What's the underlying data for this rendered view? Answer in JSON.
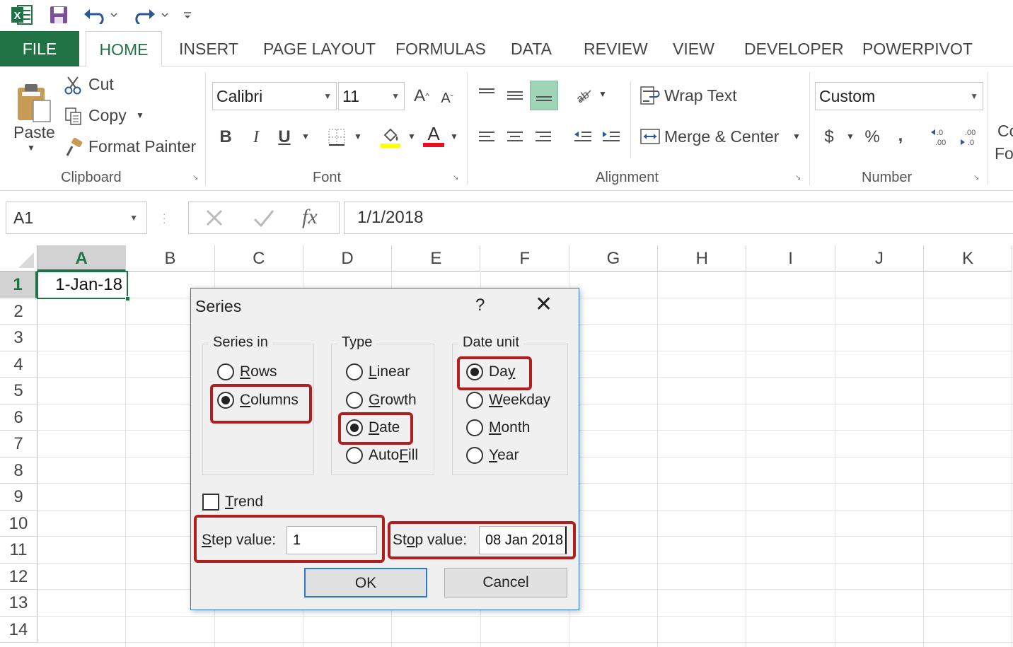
{
  "qat": {
    "icons": [
      "excel-logo-icon",
      "save-icon",
      "undo-icon",
      "redo-icon",
      "customize-qat-icon"
    ]
  },
  "tabs": [
    "FILE",
    "HOME",
    "INSERT",
    "PAGE LAYOUT",
    "FORMULAS",
    "DATA",
    "REVIEW",
    "VIEW",
    "DEVELOPER",
    "POWERPIVOT"
  ],
  "active_tab": "HOME",
  "ribbon": {
    "clipboard": {
      "paste": "Paste",
      "cut": "Cut",
      "copy": "Copy",
      "format_painter": "Format Painter",
      "label": "Clipboard"
    },
    "font": {
      "font_name": "Calibri",
      "font_size": "11",
      "bold": "B",
      "italic": "I",
      "underline": "U",
      "label": "Font"
    },
    "alignment": {
      "wrap_text": "Wrap Text",
      "merge_center": "Merge & Center",
      "label": "Alignment"
    },
    "number": {
      "format": "Custom",
      "currency": "$",
      "percent": "%",
      "comma": ",",
      "label": "Number"
    },
    "overflow_top": "Co",
    "overflow_bottom": "Fo"
  },
  "formula_bar": {
    "name_box": "A1",
    "fx": "fx",
    "value": "1/1/2018"
  },
  "grid": {
    "columns": [
      "A",
      "B",
      "C",
      "D",
      "E",
      "F",
      "G",
      "H",
      "I",
      "J",
      "K"
    ],
    "rows": [
      "1",
      "2",
      "3",
      "4",
      "5",
      "6",
      "7",
      "8",
      "9",
      "10",
      "11",
      "12",
      "13",
      "14"
    ],
    "a1_value": "1-Jan-18"
  },
  "dialog": {
    "title": "Series",
    "help": "?",
    "close": "✕",
    "series_in": {
      "legend": "Series in",
      "options": [
        {
          "label_ul": "R",
          "label_rest": "ows",
          "selected": false
        },
        {
          "label_ul": "C",
          "label_rest": "olumns",
          "selected": true
        }
      ]
    },
    "type": {
      "legend": "Type",
      "options": [
        {
          "label_ul": "L",
          "label_rest": "inear",
          "selected": false
        },
        {
          "label_ul": "G",
          "label_rest": "rowth",
          "selected": false
        },
        {
          "label_ul": "D",
          "label_rest": "ate",
          "selected": true
        },
        {
          "label_pre": "Auto",
          "label_ul": "F",
          "label_rest": "ill",
          "selected": false
        }
      ]
    },
    "date_unit": {
      "legend": "Date unit",
      "options": [
        {
          "label_pre": "Da",
          "label_ul": "y",
          "label_rest": "",
          "selected": true
        },
        {
          "label_ul": "W",
          "label_rest": "eekday",
          "selected": false
        },
        {
          "label_ul": "M",
          "label_rest": "onth",
          "selected": false
        },
        {
          "label_ul": "Y",
          "label_rest": "ear",
          "selected": false
        }
      ]
    },
    "trend": {
      "label_ul": "T",
      "label_rest": "rend",
      "checked": false
    },
    "step": {
      "label_ul": "S",
      "label_rest": "tep value:",
      "value": "1"
    },
    "stop": {
      "label_pre": "St",
      "label_ul": "o",
      "label_rest": "p value:",
      "value": "08 Jan 2018"
    },
    "ok": "OK",
    "cancel": "Cancel"
  },
  "colors": {
    "excel_green": "#217346",
    "highlight_red": "#b11e1e",
    "dialog_border": "#2b79d0"
  }
}
